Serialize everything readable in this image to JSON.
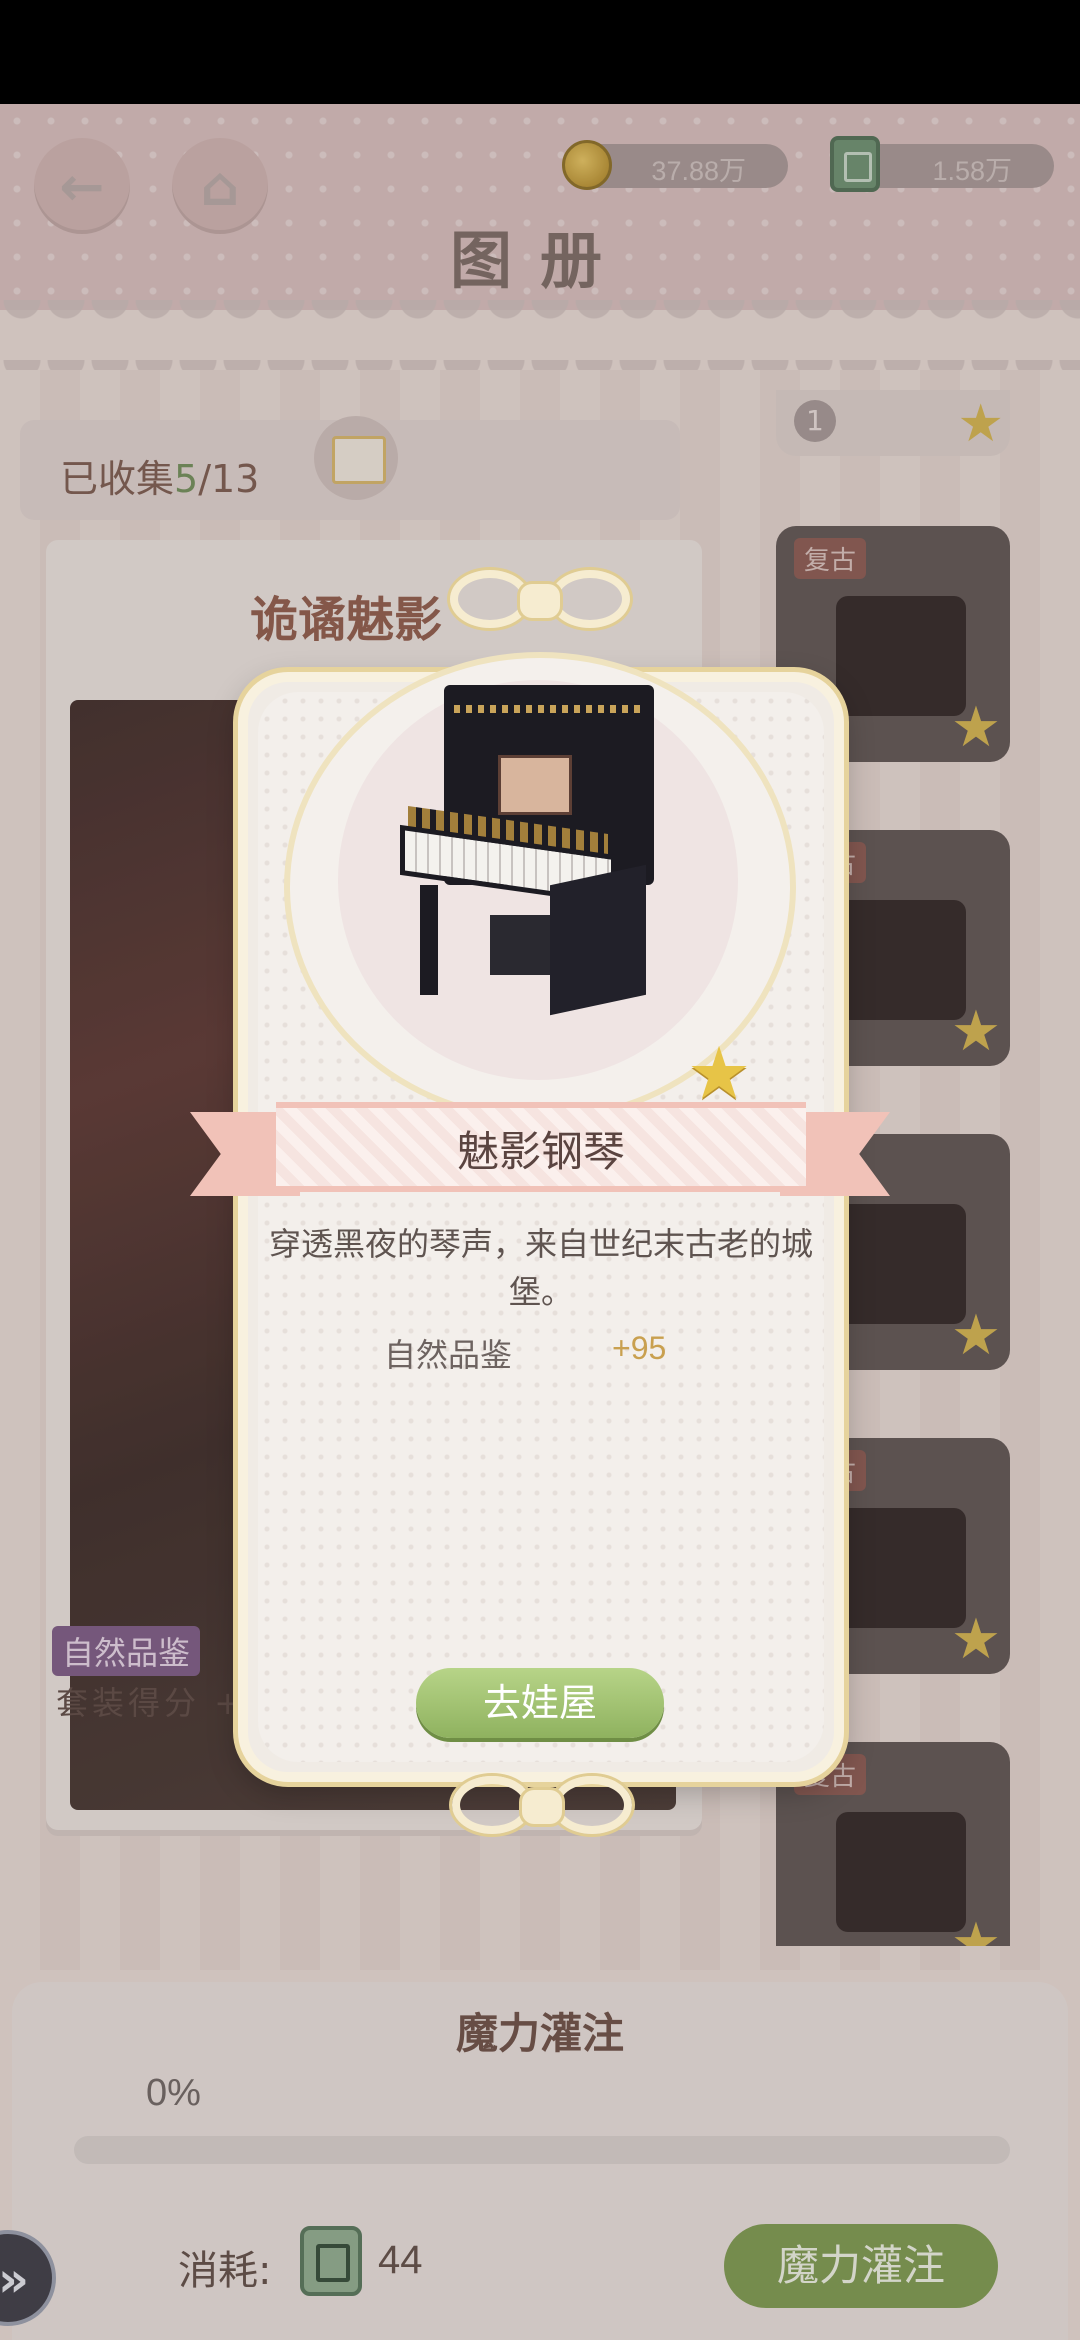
{
  "header": {
    "title": "图册",
    "back_icon": "arrow-left-icon",
    "home_icon": "home-icon",
    "coins": "37.88万",
    "tickets": "1.58万"
  },
  "collection": {
    "prefix": "已收集",
    "collected": "5",
    "total": "/13",
    "gift_icon": "gift-icon"
  },
  "album": {
    "title": "诡谲魅影",
    "tag": "自然品鉴",
    "score_label": "套装得分",
    "score_partial": "+"
  },
  "side_list": {
    "top_count": "1",
    "tag": "复古",
    "star_icon": "star-icon"
  },
  "popup": {
    "item_name": "魅影钢琴",
    "description": "穿透黑夜的琴声，来自世纪末古老的城堡。",
    "stat_label": "自然品鉴",
    "stat_value": "+95",
    "go_button": "去娃屋",
    "star_icon": "star-icon"
  },
  "bottom": {
    "title": "魔力灌注",
    "progress_text": "0%",
    "progress_fraction": 0,
    "cost_label": "消耗:",
    "cost_value": "44",
    "action_button": "魔力灌注"
  },
  "colors": {
    "accent_green": "#8fb25f",
    "gold": "#e7c447",
    "ribbon_pink": "#f1c2b8"
  }
}
